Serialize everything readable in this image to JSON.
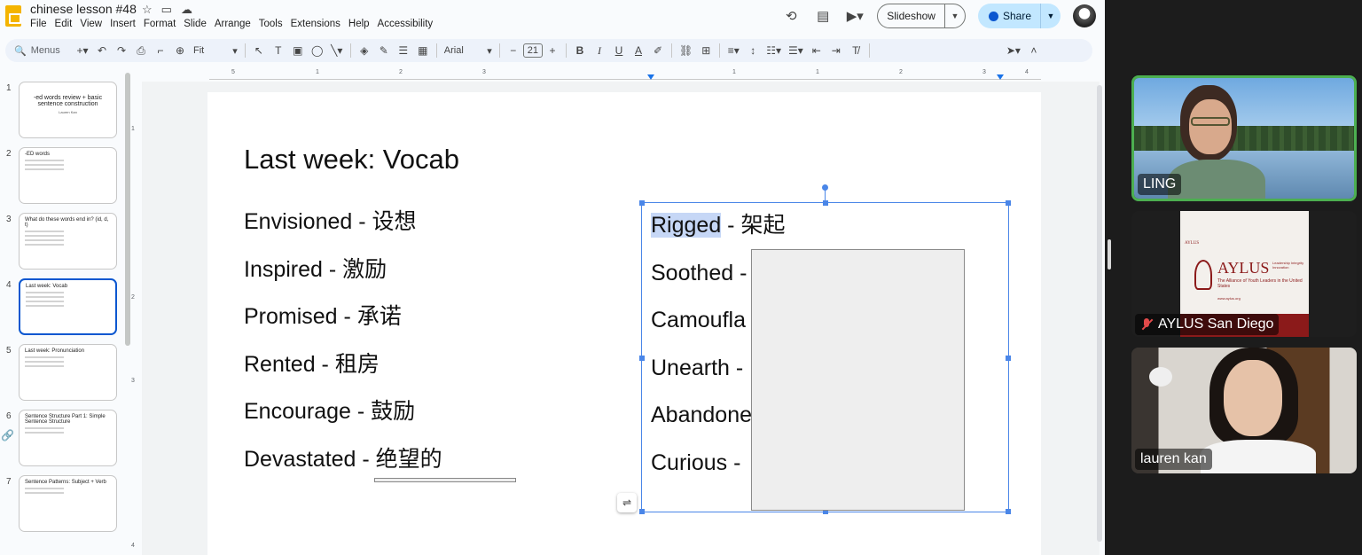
{
  "app": {
    "doc_title": "chinese lesson #48",
    "menu": [
      "File",
      "Edit",
      "View",
      "Insert",
      "Format",
      "Slide",
      "Arrange",
      "Tools",
      "Extensions",
      "Help",
      "Accessibility"
    ],
    "slideshow_label": "Slideshow",
    "share_label": "Share"
  },
  "toolbar": {
    "search_placeholder": "Menus",
    "zoom": "Fit",
    "font": "Arial",
    "font_size": "21"
  },
  "ruler": {
    "h_ticks": [
      "5",
      "1",
      "2",
      "3",
      "1",
      "1",
      "2",
      "3",
      "4"
    ],
    "v_ticks": [
      "1",
      "2",
      "3",
      "4"
    ]
  },
  "filmstrip": {
    "slides": [
      {
        "num": "1",
        "title": "-ed words review + basic sentence construction",
        "sub": "Lauren Kan"
      },
      {
        "num": "2",
        "title": "-ED words"
      },
      {
        "num": "3",
        "title": "What do these words end in? (id, d, t)"
      },
      {
        "num": "4",
        "title": "Last week: Vocab"
      },
      {
        "num": "5",
        "title": "Last week: Pronunciation"
      },
      {
        "num": "6",
        "title": "Sentence Structure Part 1: Simple Sentence Structure"
      },
      {
        "num": "7",
        "title": "Sentence Patterns: Subject + Verb"
      }
    ]
  },
  "slide": {
    "title": "Last week: Vocab",
    "left_vocab": [
      "Envisioned - 设想",
      "Inspired - 激励",
      "Promised - 承诺",
      "Rented - 租房",
      "Encourage - 鼓励",
      "Devastated - 绝望的"
    ],
    "right_vocab": [
      {
        "highlight": "Rigged",
        "rest": " - 架起"
      },
      {
        "highlight": "",
        "rest": "Soothed -"
      },
      {
        "highlight": "",
        "rest": "Camoufla"
      },
      {
        "highlight": "",
        "rest": "Unearth -"
      },
      {
        "highlight": "",
        "rest": "Abandone"
      },
      {
        "highlight": "",
        "rest": "Curious -"
      }
    ]
  },
  "meeting": {
    "participants": [
      {
        "name": "LING",
        "muted": false,
        "speaking": true
      },
      {
        "name": "AYLUS San Diego",
        "muted": true,
        "speaking": false
      },
      {
        "name": "lauren kan",
        "muted": false,
        "speaking": false
      }
    ],
    "aylus_card": {
      "small_label": "AYLUS",
      "logo_word": "AYLUS",
      "motto": "Leadership Integrity Innovation",
      "desc": "The Alliance of Youth Leaders in the United States",
      "url": "www.aylus.org"
    }
  }
}
